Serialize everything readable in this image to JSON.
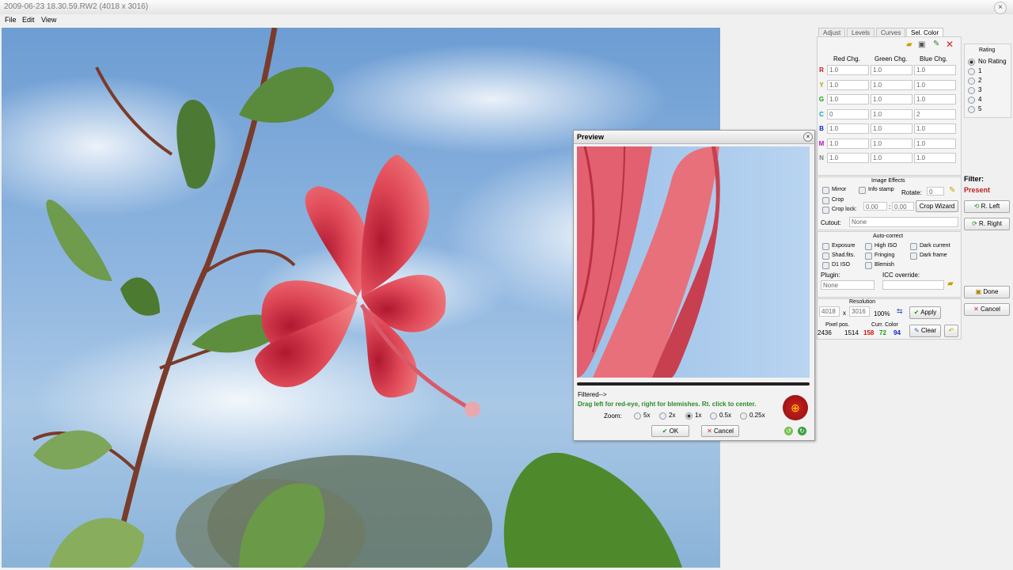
{
  "window": {
    "title": "2009-06-23 18.30.59.RW2 (4018 x 3016)",
    "close": "×"
  },
  "menu": [
    "File",
    "Edit",
    "View"
  ],
  "tabs": [
    "Adjust",
    "Levels",
    "Curves",
    "Sel. Color"
  ],
  "selcolor": {
    "headers": [
      "Red Chg.",
      "Green Chg.",
      "Blue Chg."
    ],
    "rows": [
      {
        "label": "R",
        "color": "#d01010",
        "values": [
          "1.0",
          "1.0",
          "1.0"
        ]
      },
      {
        "label": "Y",
        "color": "#b0a000",
        "values": [
          "1.0",
          "1.0",
          "1.0"
        ]
      },
      {
        "label": "G",
        "color": "#10a010",
        "values": [
          "1.0",
          "1.0",
          "1.0"
        ]
      },
      {
        "label": "C",
        "color": "#10a0b0",
        "values": [
          "0",
          "1.0",
          "2"
        ]
      },
      {
        "label": "B",
        "color": "#1020d0",
        "values": [
          "1.0",
          "1.0",
          "1.0"
        ]
      },
      {
        "label": "M",
        "color": "#c010c0",
        "values": [
          "1.0",
          "1.0",
          "1.0"
        ]
      },
      {
        "label": "N",
        "color": "#808080",
        "values": [
          "1.0",
          "1.0",
          "1.0"
        ]
      }
    ]
  },
  "rating": {
    "title": "Rating",
    "options": [
      "No Rating",
      "1",
      "2",
      "3",
      "4",
      "5"
    ],
    "selected": "No Rating"
  },
  "filter": {
    "label": "Filter:",
    "value": "Present"
  },
  "rotate_buttons": {
    "left": "R. Left",
    "right": "R. Right"
  },
  "image_effects": {
    "title": "Image Effects",
    "mirror": "Mirror",
    "info_stamp": "Info stamp",
    "rotate_label": "Rotate:",
    "rotate_value": "0",
    "crop": "Crop",
    "crop_lock": "Crop lock:",
    "crop_a": "0.00",
    "crop_sep": ":",
    "crop_b": "0.00",
    "crop_wizard": "Crop Wizard",
    "cutout_label": "Cutout:",
    "cutout_value": "None"
  },
  "auto_correct": {
    "title": "Auto-correct",
    "items": [
      "Exposure",
      "High ISO",
      "Dark current",
      "Shad.fits.",
      "Fringing",
      "Dark frame",
      "D1 ISO",
      "Blemish"
    ],
    "plugin_label": "Plugin:",
    "plugin_value": "None",
    "icc_label": "ICC override:"
  },
  "resolution": {
    "title": "Resolution",
    "width": "4018",
    "x": "x",
    "height": "3016",
    "percent": "100%",
    "apply": "Apply"
  },
  "pixel": {
    "pos_label": "Pixel pos.",
    "x": "2436",
    "y": "1514",
    "color_label": "Curr. Color",
    "r": "158",
    "g": "72",
    "b": "94",
    "clear": "Clear"
  },
  "actions": {
    "done": "Done",
    "cancel": "Cancel"
  },
  "preview": {
    "title": "Preview",
    "close": "×",
    "filtered": "Filtered-->",
    "hint": "Drag left for red-eye, right for blemishes.  Rt. click to center.",
    "zoom_label": "Zoom:",
    "zooms": [
      "5x",
      "2x",
      "1x",
      "0.5x",
      "0.25x"
    ],
    "zoom_selected": "1x",
    "ok": "OK",
    "cancel": "Cancel"
  }
}
